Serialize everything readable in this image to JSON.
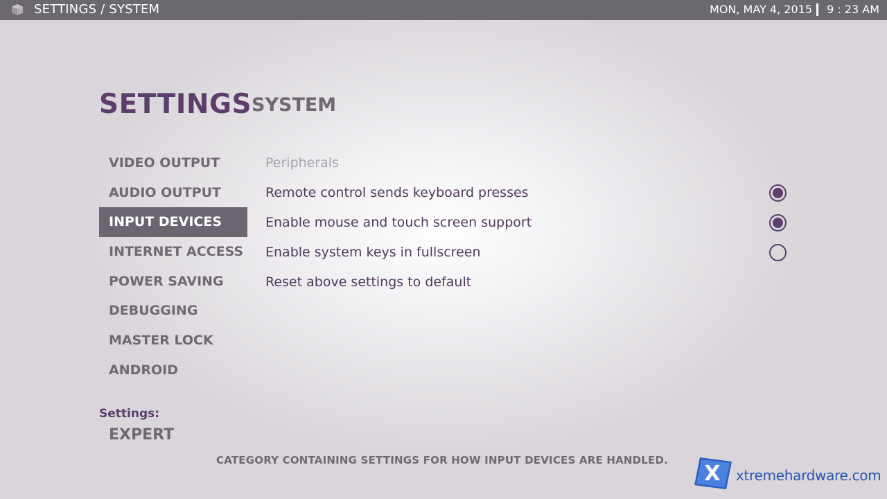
{
  "topbar": {
    "breadcrumb": "SETTINGS / SYSTEM",
    "date": "MON, MAY 4, 2015",
    "time": "9 : 23 AM",
    "icon": "cube-icon"
  },
  "header": {
    "title": "SETTINGS",
    "subtitle": "SYSTEM"
  },
  "sidebar": {
    "items": [
      {
        "label": "VIDEO OUTPUT",
        "active": false
      },
      {
        "label": "AUDIO OUTPUT",
        "active": false
      },
      {
        "label": "INPUT DEVICES",
        "active": true
      },
      {
        "label": "INTERNET ACCESS",
        "active": false
      },
      {
        "label": "POWER SAVING",
        "active": false
      },
      {
        "label": "DEBUGGING",
        "active": false
      },
      {
        "label": "MASTER LOCK",
        "active": false
      },
      {
        "label": "ANDROID",
        "active": false
      }
    ]
  },
  "main": {
    "section": "Peripherals",
    "options": [
      {
        "label": "Remote control sends keyboard presses",
        "enabled": true
      },
      {
        "label": "Enable mouse and touch screen support",
        "enabled": true
      },
      {
        "label": "Enable system keys in fullscreen",
        "enabled": false
      }
    ],
    "reset_label": "Reset above settings to default"
  },
  "settings_level": {
    "label": "Settings:",
    "value": "EXPERT"
  },
  "hint": "CATEGORY CONTAINING SETTINGS FOR HOW INPUT DEVICES ARE HANDLED.",
  "watermark": {
    "text": "xtremehardware.com",
    "logo_letter": "X"
  },
  "colors": {
    "accent": "#5b3f6a",
    "topbar": "#6c696e",
    "active_item": "#6b6570",
    "watermark": "#2a55b0"
  }
}
